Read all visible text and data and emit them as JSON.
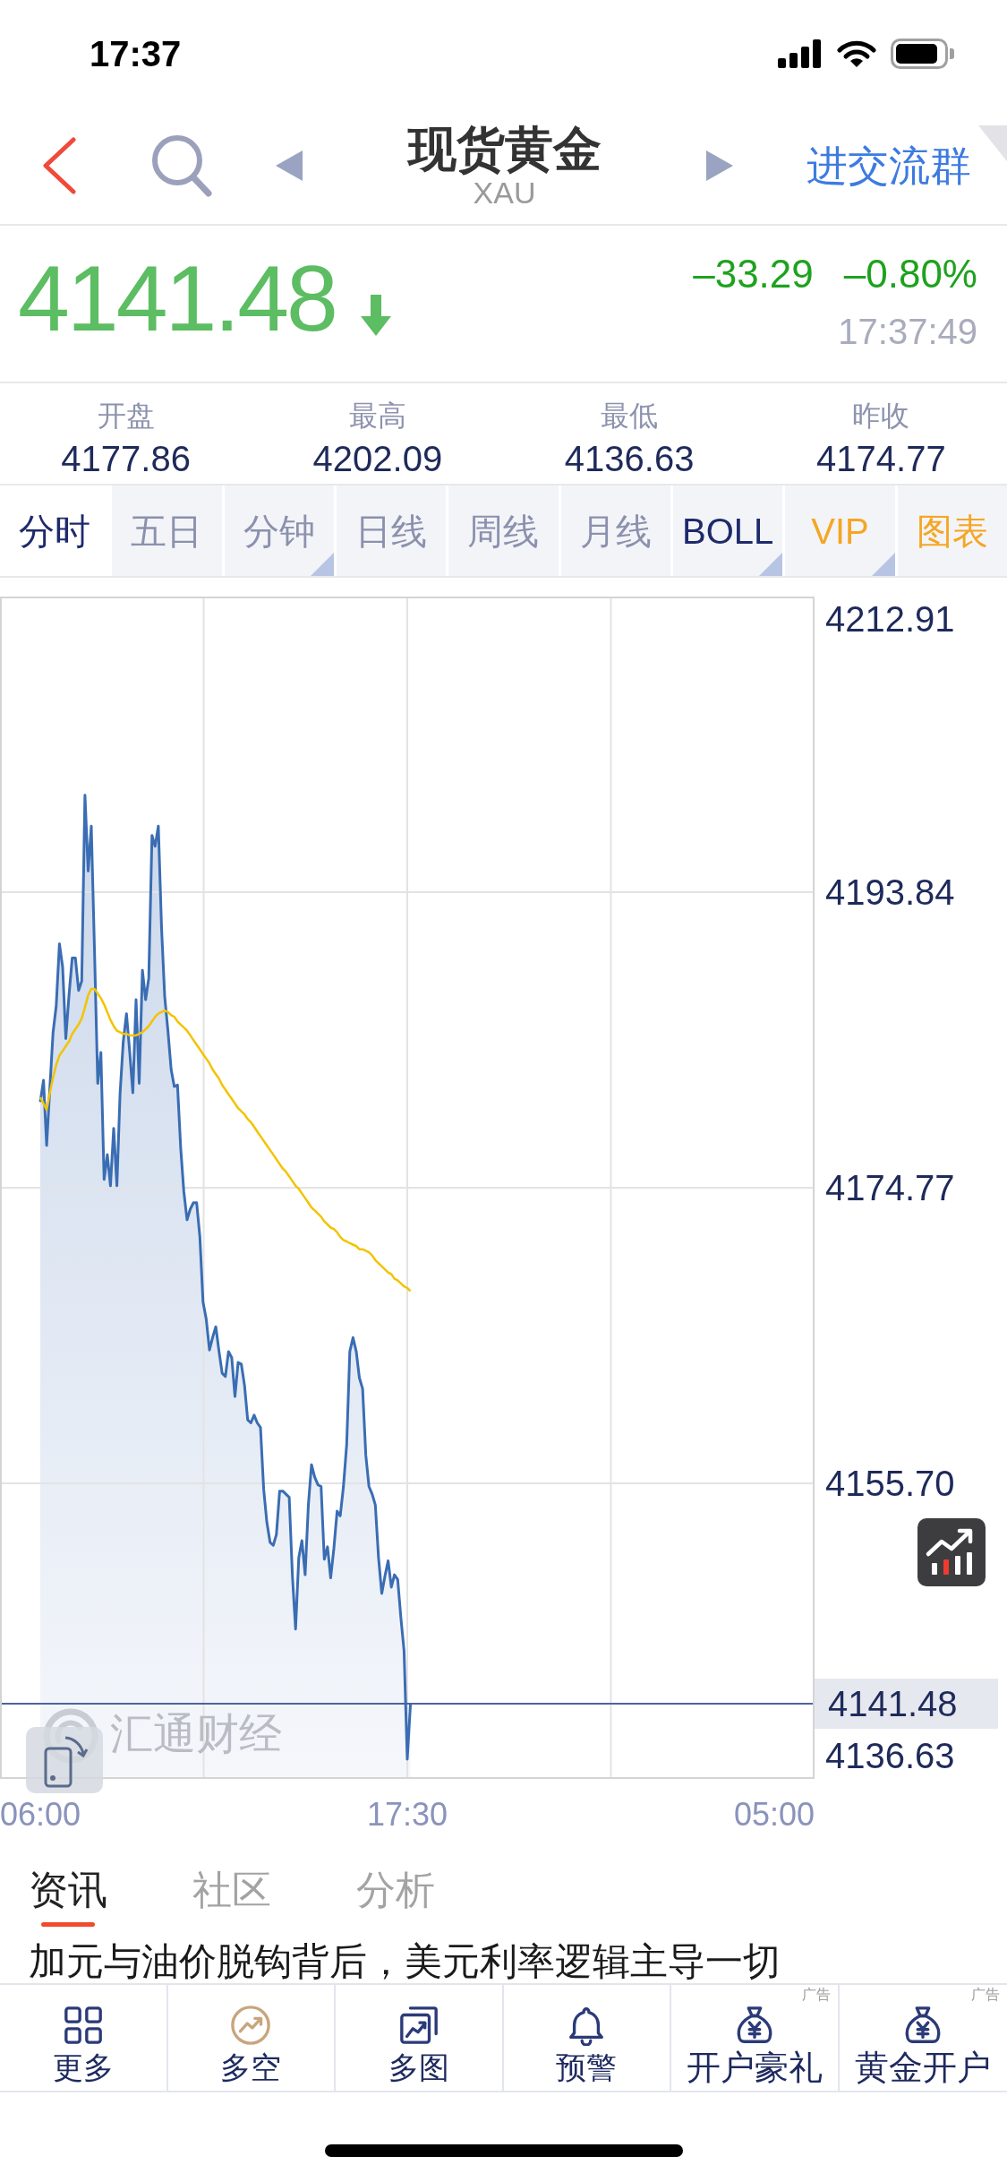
{
  "status_bar": {
    "time": "17:37"
  },
  "nav_bar": {
    "title": "现货黄金",
    "subtitle": "XAU",
    "action": "进交流群"
  },
  "quote": {
    "price": "4141.48",
    "falling": true,
    "change": "–33.29",
    "change_percent": "–0.80%",
    "time": "17:37:49"
  },
  "stats": [
    {
      "label": "开盘",
      "value": "4177.86"
    },
    {
      "label": "最高",
      "value": "4202.09"
    },
    {
      "label": "最低",
      "value": "4136.63"
    },
    {
      "label": "昨收",
      "value": "4174.77"
    }
  ],
  "period_tabs": [
    {
      "label": "分时",
      "kind": "period",
      "selected": true,
      "dropdown": false
    },
    {
      "label": "五日",
      "kind": "period",
      "selected": false,
      "dropdown": false
    },
    {
      "label": "分钟",
      "kind": "period",
      "selected": false,
      "dropdown": true
    },
    {
      "label": "日线",
      "kind": "period",
      "selected": false,
      "dropdown": false
    },
    {
      "label": "周线",
      "kind": "period",
      "selected": false,
      "dropdown": false
    },
    {
      "label": "月线",
      "kind": "period",
      "selected": false,
      "dropdown": false
    },
    {
      "label": "BOLL",
      "kind": "indicator",
      "selected": false,
      "dropdown": true
    },
    {
      "label": "VIP",
      "kind": "promo",
      "selected": false,
      "dropdown": true
    },
    {
      "label": "图表",
      "kind": "promo",
      "selected": false,
      "dropdown": false
    }
  ],
  "chart": {
    "logo_text": "汇通财经",
    "chart_data": {
      "type": "line",
      "grid": true,
      "categories": [
        "06:00",
        null,
        null,
        null,
        null,
        null,
        null,
        null,
        null,
        null,
        null,
        null,
        null,
        null,
        null,
        null,
        null,
        null,
        null,
        null,
        null,
        null,
        null,
        null,
        null,
        null,
        null,
        null,
        null,
        null,
        null,
        null,
        null,
        null,
        null,
        null,
        null,
        null,
        null,
        null,
        null,
        null,
        null,
        null,
        null,
        null,
        null,
        null,
        null,
        null,
        null,
        null,
        null,
        null,
        null,
        null,
        null,
        null,
        null,
        null,
        null,
        null,
        null,
        null,
        null,
        null,
        null,
        null,
        null,
        null,
        null,
        null,
        null,
        null,
        null,
        null,
        null,
        null,
        null,
        null,
        null,
        null,
        null,
        null,
        null,
        null,
        null,
        null,
        null,
        null,
        null,
        null,
        null,
        null,
        null,
        null,
        null,
        null,
        null,
        null,
        null,
        null,
        null,
        null,
        null,
        null,
        null,
        null,
        null,
        null,
        null,
        null,
        null,
        null,
        null,
        "17:30",
        null,
        null,
        null,
        null,
        null,
        null,
        null,
        null,
        null,
        null,
        null,
        null,
        null,
        null,
        null,
        null,
        null,
        null,
        null,
        null,
        null,
        null,
        null,
        null,
        null,
        null,
        null,
        null,
        null,
        null,
        null,
        null,
        null,
        null,
        null,
        null,
        null,
        null,
        null,
        null,
        null,
        null,
        null,
        null,
        null,
        null,
        null,
        null,
        null,
        null,
        null,
        null,
        null,
        null,
        null,
        null,
        null,
        null,
        null,
        null,
        null,
        null,
        null,
        null,
        null,
        null,
        null,
        null,
        null,
        null,
        null,
        null,
        null,
        null,
        null,
        null,
        null,
        null,
        null,
        null,
        null,
        null,
        null,
        null,
        null,
        null,
        null,
        null,
        null,
        null,
        null,
        null,
        null,
        null,
        null,
        null,
        null,
        null,
        null,
        null,
        null,
        null,
        null,
        null,
        null,
        null,
        null,
        null,
        null,
        null,
        null,
        null,
        null,
        null,
        "05:00"
      ],
      "series": [
        {
          "color": "#3a6db3",
          "values": [
            4180.3,
            4181.7,
            4177.5,
            4181.2,
            4184.8,
            4186.5,
            4190.5,
            4189.0,
            4184.4,
            4187.2,
            4189.6,
            4189.6,
            4187.5,
            4188.1,
            4200.1,
            4195.2,
            4198.1,
            4190.0,
            4181.5,
            4183.5,
            4175.3,
            4176.9,
            4174.9,
            4178.6,
            4174.9,
            4180.8,
            4184.2,
            4186.0,
            4183.6,
            4180.9,
            4186.9,
            4181.5,
            4188.8,
            4186.9,
            4188.3,
            4197.5,
            4196.8,
            4198.1,
            4191.5,
            4187.1,
            4184.9,
            4182.4,
            4181.3,
            4181.4,
            4177.3,
            4174.5,
            4172.7,
            4173.4,
            4173.8,
            4173.8,
            4171.6,
            4167.4,
            4166.3,
            4164.3,
            4165.1,
            4165.8,
            4164.2,
            4162.8,
            4162.6,
            4164.2,
            4163.8,
            4161.3,
            4163.5,
            4163.4,
            4162.0,
            4159.8,
            4159.6,
            4160.1,
            4159.6,
            4159.3,
            4155.3,
            4153.2,
            4151.9,
            4151.7,
            4152.4,
            4155.2,
            4155.2,
            4155.0,
            4154.8,
            4149.7,
            4146.3,
            4150.9,
            4152.0,
            4149.8,
            4154.3,
            4156.9,
            4156.1,
            4155.6,
            4155.5,
            4150.8,
            4151.6,
            4149.6,
            4151.5,
            4153.9,
            4153.6,
            4155.5,
            4158.2,
            4164.2,
            4165.1,
            4164.2,
            4162.5,
            4161.8,
            4157.5,
            4155.5,
            4155.0,
            4154.3,
            4150.9,
            4148.6,
            4149.7,
            4150.7,
            4149.0,
            4149.8,
            4149.5,
            4147.0,
            4144.9,
            4137.9,
            4141.5,
            null,
            null,
            null,
            null,
            null,
            null,
            null,
            null,
            null,
            null,
            null,
            null,
            null,
            null,
            null,
            null,
            null,
            null,
            null,
            null,
            null,
            null,
            null,
            null,
            null,
            null,
            null,
            null,
            null,
            null,
            null,
            null,
            null,
            null,
            null,
            null,
            null,
            null,
            null,
            null,
            null,
            null,
            null,
            null,
            null,
            null,
            null,
            null,
            null,
            null,
            null,
            null,
            null,
            null,
            null,
            null,
            null,
            null,
            null,
            null,
            null,
            null,
            null,
            null,
            null,
            null,
            null,
            null,
            null,
            null,
            null,
            null,
            null,
            null,
            null,
            null,
            null,
            null,
            null,
            null,
            null,
            null,
            null,
            null,
            null,
            null,
            null,
            null,
            null,
            null,
            null,
            null,
            null,
            null,
            null,
            null,
            null,
            null,
            null,
            null,
            null,
            null,
            null,
            null,
            null,
            null,
            null,
            null,
            null,
            null,
            null,
            null,
            null,
            null
          ]
        },
        {
          "color": "#f4c300",
          "values": [
            4180.6,
            4180.2,
            4179.8,
            4180.9,
            4181.9,
            4182.7,
            4183.3,
            4183.6,
            4183.9,
            4184.2,
            4184.7,
            4185.0,
            4185.3,
            4185.7,
            4186.4,
            4187.2,
            4187.6,
            4187.6,
            4187.3,
            4187.0,
            4186.6,
            4186.1,
            4185.6,
            4185.2,
            4184.9,
            4184.8,
            4184.7,
            4184.7,
            4184.6,
            4184.6,
            4184.6,
            4184.7,
            4184.8,
            4185.0,
            4185.2,
            4185.5,
            4185.8,
            4186.0,
            4186.1,
            4186.2,
            4186.1,
            4185.9,
            4185.8,
            4185.5,
            4185.3,
            4185.1,
            4184.9,
            4184.6,
            4184.3,
            4184.0,
            4183.7,
            4183.4,
            4183.1,
            4182.8,
            4182.4,
            4182.1,
            4181.8,
            4181.4,
            4181.1,
            4180.8,
            4180.5,
            4180.2,
            4179.9,
            4179.7,
            4179.5,
            4179.2,
            4179.0,
            4178.7,
            4178.4,
            4178.1,
            4177.8,
            4177.5,
            4177.2,
            4176.9,
            4176.6,
            4176.3,
            4176.0,
            4175.8,
            4175.5,
            4175.2,
            4174.9,
            4174.7,
            4174.4,
            4174.1,
            4173.8,
            4173.5,
            4173.3,
            4173.1,
            4172.9,
            4172.6,
            4172.4,
            4172.2,
            4172.1,
            4171.9,
            4171.6,
            4171.4,
            4171.3,
            4171.2,
            4171.1,
            4171.0,
            4170.8,
            4170.8,
            4170.7,
            4170.6,
            4170.4,
            4170.1,
            4169.9,
            4169.7,
            4169.5,
            4169.3,
            4169.2,
            4168.9,
            4168.8,
            4168.6,
            4168.4,
            4168.3,
            4168.1,
            null,
            null,
            null,
            null,
            null,
            null,
            null,
            null,
            null,
            null,
            null,
            null,
            null,
            null,
            null,
            null,
            null,
            null,
            null,
            null,
            null,
            null,
            null,
            null,
            null,
            null,
            null,
            null,
            null,
            null,
            null,
            null,
            null,
            null,
            null,
            null,
            null,
            null,
            null,
            null,
            null,
            null,
            null,
            null,
            null,
            null,
            null,
            null,
            null,
            null,
            null,
            null,
            null,
            null,
            null,
            null,
            null,
            null,
            null,
            null,
            null,
            null,
            null,
            null,
            null,
            null,
            null,
            null,
            null,
            null,
            null,
            null,
            null,
            null,
            null,
            null,
            null,
            null,
            null,
            null,
            null,
            null,
            null,
            null,
            null,
            null,
            null,
            null,
            null,
            null,
            null,
            null,
            null,
            null,
            null,
            null,
            null,
            null,
            null,
            null,
            null,
            null,
            null,
            null,
            null,
            null,
            null,
            null,
            null,
            null,
            null,
            null,
            null,
            null
          ]
        }
      ],
      "ylim": [
        4136.63,
        4212.91
      ],
      "yticks": [
        {
          "value": 4212.91,
          "label": "4212.91"
        },
        {
          "value": 4193.84,
          "label": "4193.84"
        },
        {
          "value": 4174.77,
          "label": "4174.77"
        },
        {
          "value": 4155.7,
          "label": "4155.70"
        },
        {
          "value": 4136.63,
          "label": "4136.63"
        }
      ],
      "ref_lines": [
        {
          "axis": "y",
          "value": 4141.48,
          "label": "4141.48"
        }
      ]
    }
  },
  "news_tabs": [
    {
      "label": "资讯",
      "selected": true
    },
    {
      "label": "社区",
      "selected": false
    },
    {
      "label": "分析",
      "selected": false
    }
  ],
  "headline": "加元与油价脱钩背后，美元利率逻辑主导一切",
  "toolbar": [
    {
      "label": "更多",
      "kind": "grid"
    },
    {
      "label": "多空",
      "kind": "trend"
    },
    {
      "label": "多图",
      "kind": "charts"
    },
    {
      "label": "预警",
      "kind": "bell"
    },
    {
      "label": "开户豪礼",
      "kind": "moneybag",
      "ad_label": "广告"
    },
    {
      "label": "黄金开户",
      "kind": "moneybag",
      "ad_label": "广告"
    }
  ]
}
